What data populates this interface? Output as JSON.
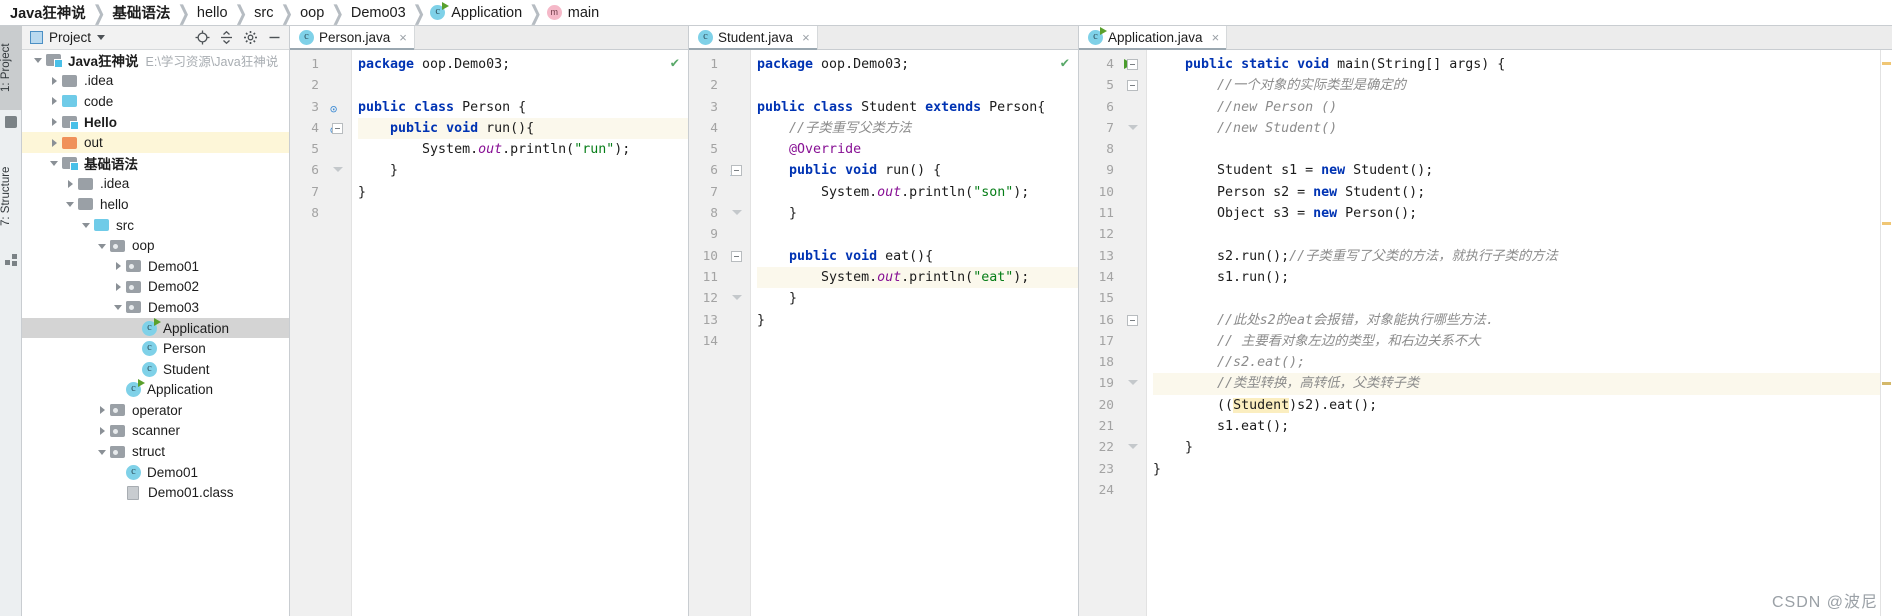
{
  "breadcrumb": [
    {
      "label": "Java狂神说",
      "bold": true,
      "icon": null
    },
    {
      "label": "基础语法",
      "bold": true,
      "icon": null
    },
    {
      "label": "hello",
      "bold": false,
      "icon": null
    },
    {
      "label": "src",
      "bold": false,
      "icon": null
    },
    {
      "label": "oop",
      "bold": false,
      "icon": null
    },
    {
      "label": "Demo03",
      "bold": false,
      "icon": null
    },
    {
      "label": "Application",
      "bold": false,
      "icon": "class-runnable-icon"
    },
    {
      "label": "main",
      "bold": false,
      "icon": "method-icon"
    }
  ],
  "rail": {
    "project_label": "1: Project",
    "structure_label": "7: Structure"
  },
  "project_panel": {
    "title": "Project",
    "actions": [
      "locate-icon",
      "collapse-all-icon",
      "settings-icon",
      "hide-icon"
    ],
    "tree": [
      {
        "indent": 0,
        "twist": "open",
        "icon": "module",
        "label": "Java狂神说",
        "bold": true,
        "path": "E:\\学习资源\\Java狂神说",
        "state": "normal"
      },
      {
        "indent": 1,
        "twist": "closed",
        "icon": "gray",
        "label": ".idea",
        "bold": false,
        "path": "",
        "state": "normal"
      },
      {
        "indent": 1,
        "twist": "closed",
        "icon": "blue",
        "label": "code",
        "bold": false,
        "path": "",
        "state": "normal"
      },
      {
        "indent": 1,
        "twist": "closed",
        "icon": "module",
        "label": "Hello",
        "bold": true,
        "path": "",
        "state": "normal"
      },
      {
        "indent": 1,
        "twist": "closed",
        "icon": "orange",
        "label": "out",
        "bold": false,
        "path": "",
        "state": "highlight"
      },
      {
        "indent": 1,
        "twist": "open",
        "icon": "module",
        "label": "基础语法",
        "bold": true,
        "path": "",
        "state": "normal"
      },
      {
        "indent": 2,
        "twist": "closed",
        "icon": "gray",
        "label": ".idea",
        "bold": false,
        "path": "",
        "state": "normal"
      },
      {
        "indent": 2,
        "twist": "open",
        "icon": "gray",
        "label": "hello",
        "bold": false,
        "path": "",
        "state": "normal"
      },
      {
        "indent": 3,
        "twist": "open",
        "icon": "blue",
        "label": "src",
        "bold": false,
        "path": "",
        "state": "normal"
      },
      {
        "indent": 4,
        "twist": "open",
        "icon": "pkg",
        "label": "oop",
        "bold": false,
        "path": "",
        "state": "normal"
      },
      {
        "indent": 5,
        "twist": "closed",
        "icon": "pkg",
        "label": "Demo01",
        "bold": false,
        "path": "",
        "state": "normal"
      },
      {
        "indent": 5,
        "twist": "closed",
        "icon": "pkg",
        "label": "Demo02",
        "bold": false,
        "path": "",
        "state": "normal"
      },
      {
        "indent": 5,
        "twist": "open",
        "icon": "pkg",
        "label": "Demo03",
        "bold": false,
        "path": "",
        "state": "normal"
      },
      {
        "indent": 6,
        "twist": "none",
        "icon": "class-runnable",
        "label": "Application",
        "bold": false,
        "path": "",
        "state": "selected"
      },
      {
        "indent": 6,
        "twist": "none",
        "icon": "class",
        "label": "Person",
        "bold": false,
        "path": "",
        "state": "normal"
      },
      {
        "indent": 6,
        "twist": "none",
        "icon": "class",
        "label": "Student",
        "bold": false,
        "path": "",
        "state": "normal"
      },
      {
        "indent": 5,
        "twist": "none",
        "icon": "class-runnable",
        "label": "Application",
        "bold": false,
        "path": "",
        "state": "normal"
      },
      {
        "indent": 4,
        "twist": "closed",
        "icon": "pkg",
        "label": "operator",
        "bold": false,
        "path": "",
        "state": "normal"
      },
      {
        "indent": 4,
        "twist": "closed",
        "icon": "pkg",
        "label": "scanner",
        "bold": false,
        "path": "",
        "state": "normal"
      },
      {
        "indent": 4,
        "twist": "open",
        "icon": "pkg",
        "label": "struct",
        "bold": false,
        "path": "",
        "state": "normal"
      },
      {
        "indent": 5,
        "twist": "none",
        "icon": "class",
        "label": "Demo01",
        "bold": false,
        "path": "",
        "state": "normal"
      },
      {
        "indent": 5,
        "twist": "none",
        "icon": "file",
        "label": "Demo01.class",
        "bold": false,
        "path": "",
        "state": "normal"
      }
    ]
  },
  "editors": [
    {
      "tab": {
        "label": "Person.java",
        "icon": "class-icon",
        "active": true,
        "close": "×"
      },
      "inspection_ok": "✔",
      "first_line": 1,
      "lines": [
        {
          "n": 1,
          "gutter_icon": "",
          "fold": "",
          "highlight": false,
          "tokens": [
            {
              "t": "kw",
              "v": "package "
            },
            {
              "t": "plain",
              "v": "oop.Demo03;"
            }
          ]
        },
        {
          "n": 2,
          "gutter_icon": "",
          "fold": "",
          "highlight": false,
          "tokens": []
        },
        {
          "n": 3,
          "gutter_icon": "class-marker",
          "fold": "",
          "highlight": false,
          "tokens": [
            {
              "t": "kw",
              "v": "public class "
            },
            {
              "t": "plain",
              "v": "Person {"
            }
          ]
        },
        {
          "n": 4,
          "gutter_icon": "class-marker",
          "fold": "minus",
          "highlight": true,
          "indent": 1,
          "tokens": [
            {
              "t": "kw",
              "v": "public void "
            },
            {
              "t": "plain",
              "v": "run(){"
            }
          ]
        },
        {
          "n": 5,
          "gutter_icon": "",
          "fold": "",
          "highlight": false,
          "indent": 2,
          "tokens": [
            {
              "t": "plain",
              "v": "System."
            },
            {
              "t": "fld",
              "v": "out"
            },
            {
              "t": "plain",
              "v": ".println("
            },
            {
              "t": "str",
              "v": "\"run\""
            },
            {
              "t": "plain",
              "v": ");"
            }
          ]
        },
        {
          "n": 6,
          "gutter_icon": "",
          "fold": "end",
          "highlight": false,
          "indent": 1,
          "tokens": [
            {
              "t": "plain",
              "v": "}"
            }
          ]
        },
        {
          "n": 7,
          "gutter_icon": "",
          "fold": "",
          "highlight": false,
          "tokens": [
            {
              "t": "plain",
              "v": "}"
            }
          ]
        },
        {
          "n": 8,
          "gutter_icon": "",
          "fold": "",
          "highlight": false,
          "tokens": []
        }
      ]
    },
    {
      "tab": {
        "label": "Student.java",
        "icon": "class-icon",
        "active": true,
        "close": "×"
      },
      "inspection_ok": "✔",
      "first_line": 1,
      "lines": [
        {
          "n": 1,
          "gutter_icon": "",
          "fold": "",
          "highlight": false,
          "tokens": [
            {
              "t": "kw",
              "v": "package "
            },
            {
              "t": "plain",
              "v": "oop.Demo03;"
            }
          ]
        },
        {
          "n": 2,
          "gutter_icon": "",
          "fold": "",
          "highlight": false,
          "tokens": []
        },
        {
          "n": 3,
          "gutter_icon": "",
          "fold": "",
          "highlight": false,
          "tokens": [
            {
              "t": "kw",
              "v": "public class "
            },
            {
              "t": "plain",
              "v": "Student "
            },
            {
              "t": "kw",
              "v": "extends "
            },
            {
              "t": "plain",
              "v": "Person{"
            }
          ]
        },
        {
          "n": 4,
          "gutter_icon": "",
          "fold": "",
          "highlight": false,
          "indent": 1,
          "tokens": [
            {
              "t": "cmt",
              "v": "//子类重写父类方法"
            }
          ]
        },
        {
          "n": 5,
          "gutter_icon": "",
          "fold": "",
          "highlight": false,
          "indent": 1,
          "tokens": [
            {
              "t": "ann",
              "v": "@Override"
            }
          ]
        },
        {
          "n": 6,
          "gutter_icon": "override-marker",
          "fold": "minus",
          "highlight": false,
          "indent": 1,
          "tokens": [
            {
              "t": "kw",
              "v": "public void "
            },
            {
              "t": "plain",
              "v": "run() {"
            }
          ]
        },
        {
          "n": 7,
          "gutter_icon": "",
          "fold": "",
          "highlight": false,
          "indent": 2,
          "tokens": [
            {
              "t": "plain",
              "v": "System."
            },
            {
              "t": "fld",
              "v": "out"
            },
            {
              "t": "plain",
              "v": ".println("
            },
            {
              "t": "str",
              "v": "\"son\""
            },
            {
              "t": "plain",
              "v": ");"
            }
          ]
        },
        {
          "n": 8,
          "gutter_icon": "",
          "fold": "end",
          "highlight": false,
          "indent": 1,
          "tokens": [
            {
              "t": "plain",
              "v": "}"
            }
          ]
        },
        {
          "n": 9,
          "gutter_icon": "",
          "fold": "",
          "highlight": false,
          "tokens": []
        },
        {
          "n": 10,
          "gutter_icon": "",
          "fold": "minus",
          "highlight": false,
          "indent": 1,
          "tokens": [
            {
              "t": "kw",
              "v": "public void "
            },
            {
              "t": "plain",
              "v": "eat(){"
            }
          ]
        },
        {
          "n": 11,
          "gutter_icon": "",
          "fold": "",
          "highlight": true,
          "indent": 2,
          "tokens": [
            {
              "t": "plain",
              "v": "System."
            },
            {
              "t": "fld",
              "v": "out"
            },
            {
              "t": "plain",
              "v": ".println("
            },
            {
              "t": "str",
              "v": "\"eat\""
            },
            {
              "t": "plain",
              "v": ");"
            }
          ]
        },
        {
          "n": 12,
          "gutter_icon": "",
          "fold": "end",
          "highlight": false,
          "indent": 1,
          "tokens": [
            {
              "t": "plain",
              "v": "}"
            }
          ]
        },
        {
          "n": 13,
          "gutter_icon": "",
          "fold": "",
          "highlight": false,
          "tokens": [
            {
              "t": "plain",
              "v": "}"
            }
          ]
        },
        {
          "n": 14,
          "gutter_icon": "",
          "fold": "",
          "highlight": false,
          "tokens": []
        }
      ]
    },
    {
      "tab": {
        "label": "Application.java",
        "icon": "class-runnable-icon",
        "active": true,
        "close": "×"
      },
      "inspection_ok": "",
      "first_line": 4,
      "lines": [
        {
          "n": 4,
          "gutter_icon": "run",
          "fold": "minus",
          "highlight": false,
          "indent": 1,
          "tokens": [
            {
              "t": "kw",
              "v": "public static void "
            },
            {
              "t": "plain",
              "v": "main(String[] args) {"
            }
          ]
        },
        {
          "n": 5,
          "gutter_icon": "",
          "fold": "minus",
          "highlight": false,
          "indent": 2,
          "tokens": [
            {
              "t": "cmt",
              "v": "//一个对象的实际类型是确定的"
            }
          ]
        },
        {
          "n": 6,
          "gutter_icon": "",
          "fold": "",
          "highlight": false,
          "indent": 2,
          "tokens": [
            {
              "t": "cmt",
              "v": "//new Person ()"
            }
          ]
        },
        {
          "n": 7,
          "gutter_icon": "",
          "fold": "end",
          "highlight": false,
          "indent": 2,
          "tokens": [
            {
              "t": "cmt",
              "v": "//new Student()"
            }
          ]
        },
        {
          "n": 8,
          "gutter_icon": "",
          "fold": "",
          "highlight": false,
          "tokens": []
        },
        {
          "n": 9,
          "gutter_icon": "",
          "fold": "",
          "highlight": false,
          "indent": 2,
          "tokens": [
            {
              "t": "plain",
              "v": "Student s1 = "
            },
            {
              "t": "kw",
              "v": "new "
            },
            {
              "t": "plain",
              "v": "Student();"
            }
          ]
        },
        {
          "n": 10,
          "gutter_icon": "",
          "fold": "",
          "highlight": false,
          "indent": 2,
          "tokens": [
            {
              "t": "plain",
              "v": "Person s2 = "
            },
            {
              "t": "kw",
              "v": "new "
            },
            {
              "t": "plain",
              "v": "Student();"
            }
          ]
        },
        {
          "n": 11,
          "gutter_icon": "",
          "fold": "",
          "highlight": false,
          "indent": 2,
          "tokens": [
            {
              "t": "plain",
              "v": "Object s3 = "
            },
            {
              "t": "kw",
              "v": "new "
            },
            {
              "t": "plain",
              "v": "Person();"
            }
          ]
        },
        {
          "n": 12,
          "gutter_icon": "",
          "fold": "",
          "highlight": false,
          "tokens": []
        },
        {
          "n": 13,
          "gutter_icon": "",
          "fold": "",
          "highlight": false,
          "indent": 2,
          "tokens": [
            {
              "t": "plain",
              "v": "s2.run();"
            },
            {
              "t": "cmt",
              "v": "//子类重写了父类的方法，就执行子类的方法"
            }
          ]
        },
        {
          "n": 14,
          "gutter_icon": "",
          "fold": "",
          "highlight": false,
          "indent": 2,
          "tokens": [
            {
              "t": "plain",
              "v": "s1.run();"
            }
          ]
        },
        {
          "n": 15,
          "gutter_icon": "",
          "fold": "",
          "highlight": false,
          "tokens": []
        },
        {
          "n": 16,
          "gutter_icon": "",
          "fold": "minus",
          "highlight": false,
          "indent": 2,
          "tokens": [
            {
              "t": "cmt",
              "v": "//此处s2的eat会报错，对象能执行哪些方法."
            }
          ]
        },
        {
          "n": 17,
          "gutter_icon": "",
          "fold": "",
          "highlight": false,
          "indent": 2,
          "tokens": [
            {
              "t": "cmt",
              "v": "// 主要看对象左边的类型，和右边关系不大"
            }
          ]
        },
        {
          "n": 18,
          "gutter_icon": "",
          "fold": "",
          "highlight": false,
          "indent": 2,
          "tokens": [
            {
              "t": "cmt",
              "v": "//s2.eat();"
            }
          ]
        },
        {
          "n": 19,
          "gutter_icon": "",
          "fold": "end",
          "highlight": true,
          "indent": 2,
          "tokens": [
            {
              "t": "cmt",
              "v": "//类型转换，高转低，父类转子类"
            }
          ]
        },
        {
          "n": 20,
          "gutter_icon": "",
          "fold": "",
          "highlight": false,
          "indent": 2,
          "tokens": [
            {
              "t": "plain",
              "v": "(("
            },
            {
              "t": "hl",
              "v": "Student"
            },
            {
              "t": "plain",
              "v": ")s2).eat();"
            }
          ]
        },
        {
          "n": 21,
          "gutter_icon": "",
          "fold": "",
          "highlight": false,
          "indent": 2,
          "tokens": [
            {
              "t": "plain",
              "v": "s1.eat();"
            }
          ]
        },
        {
          "n": 22,
          "gutter_icon": "",
          "fold": "end",
          "highlight": false,
          "indent": 1,
          "tokens": [
            {
              "t": "plain",
              "v": "}"
            }
          ]
        },
        {
          "n": 23,
          "gutter_icon": "",
          "fold": "",
          "highlight": false,
          "tokens": [
            {
              "t": "plain",
              "v": "}"
            }
          ]
        },
        {
          "n": 24,
          "gutter_icon": "",
          "fold": "",
          "highlight": false,
          "tokens": []
        }
      ]
    }
  ],
  "watermark": "CSDN @波尼",
  "colors": {
    "keyword": "#0033b3",
    "string": "#067d17",
    "comment": "#8c8c8c",
    "field": "#871094",
    "selection": "#d4d4d4",
    "line_highlight": "#fbf8ec",
    "tree_highlight": "#fdf6d8",
    "run_green": "#4a9c2d"
  }
}
